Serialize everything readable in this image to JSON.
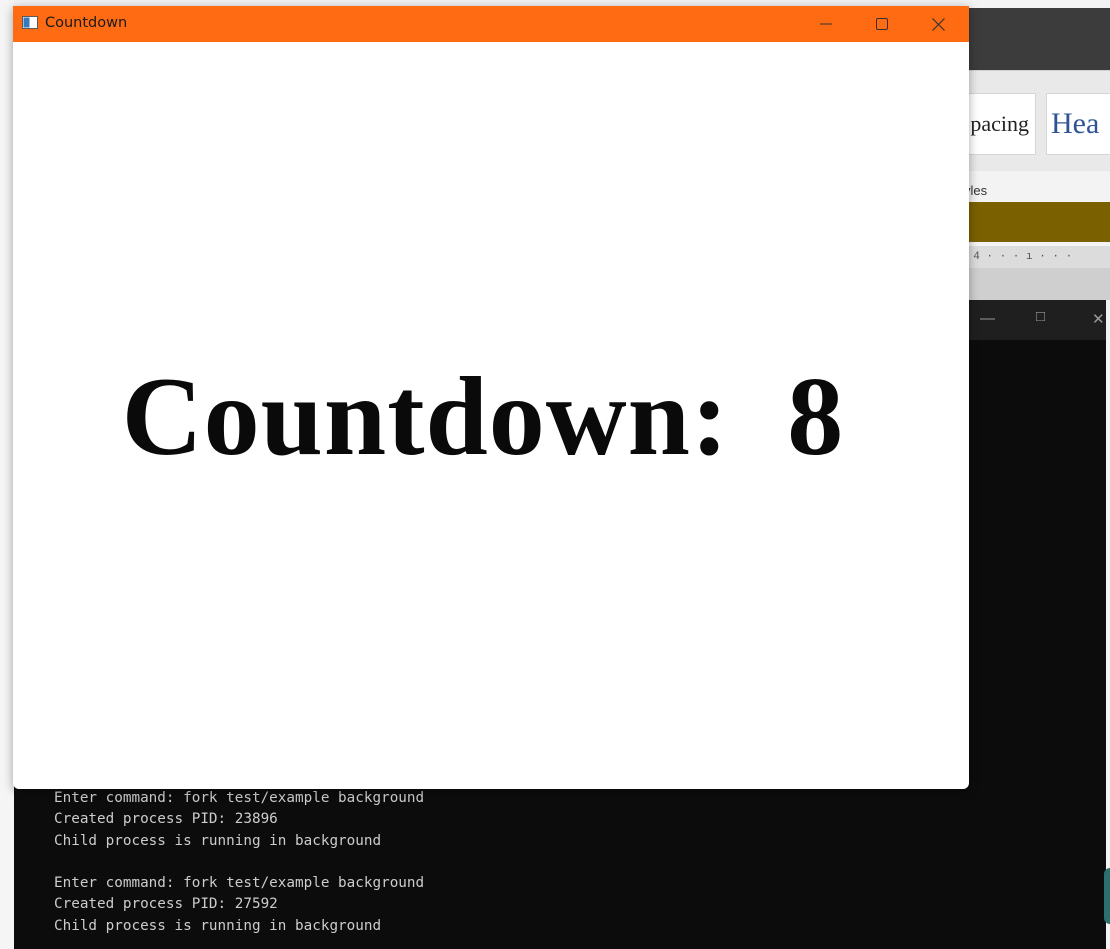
{
  "countdown_window": {
    "title": "Countdown",
    "countdown_text": "Countdown:  8",
    "titlebar_color": "#ff6b13"
  },
  "word_window": {
    "style_spacing": "pacing",
    "style_heading": "Hea",
    "styles_group_label": "yles",
    "ruler_marks": "· 4 · · · ı · · ·"
  },
  "console": {
    "lines": [
      "Enter command: fork test/example background",
      "Created process PID: 23896",
      "Child process is running in background",
      "",
      "Enter command: fork test/example background",
      "Created process PID: 27592",
      "Child process is running in background"
    ]
  },
  "icons": {
    "minimize": "minimize-icon",
    "maximize": "maximize-icon",
    "close": "close-icon",
    "app": "app-window-icon"
  }
}
